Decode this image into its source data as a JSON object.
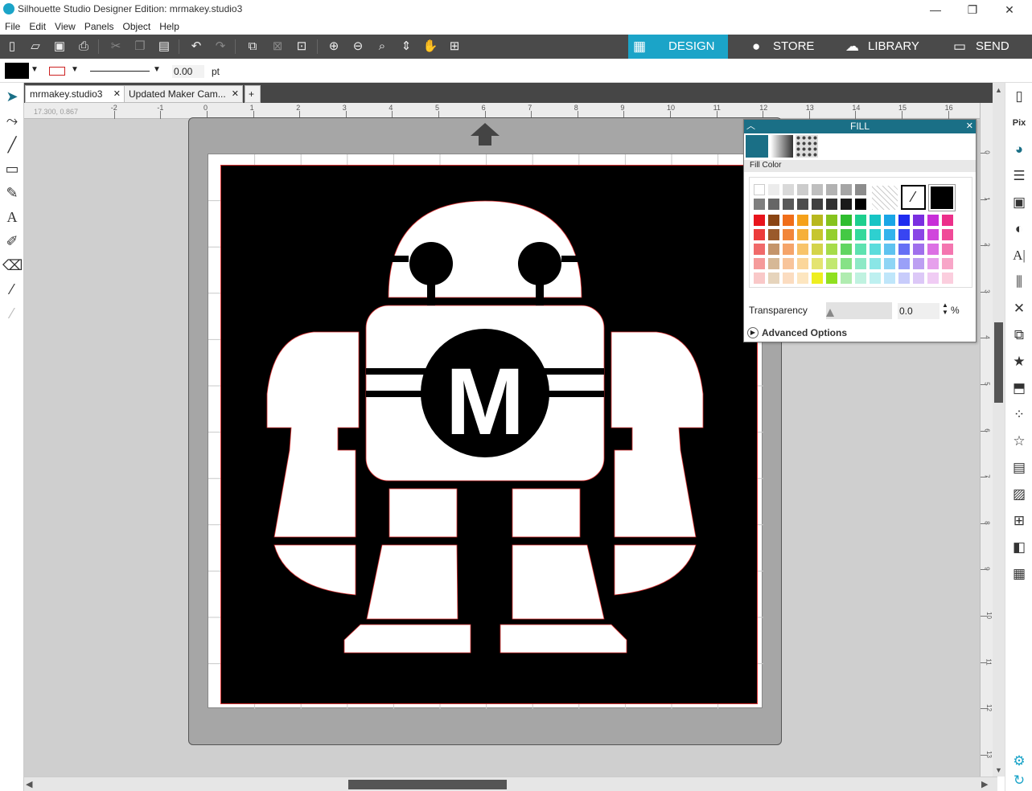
{
  "window": {
    "title": "Silhouette Studio Designer Edition: mrmakey.studio3",
    "minimize": "—",
    "maximize": "❐",
    "close": "✕"
  },
  "menu": [
    "File",
    "Edit",
    "View",
    "Panels",
    "Object",
    "Help"
  ],
  "modes": [
    {
      "label": "DESIGN",
      "icon": "grid-icon",
      "active": true
    },
    {
      "label": "STORE",
      "icon": "silhouette-s-icon",
      "active": false
    },
    {
      "label": "LIBRARY",
      "icon": "cloud-icon",
      "active": false
    },
    {
      "label": "SEND",
      "icon": "cutter-icon",
      "active": false
    }
  ],
  "propbar": {
    "line_width": "0.00",
    "unit": "pt",
    "fill_color": "#000000",
    "line_color": "#cc2222"
  },
  "tabs": [
    {
      "label": "mrmakey.studio3",
      "close": "✕"
    },
    {
      "label": "Updated Maker Cam...",
      "close": "✕"
    },
    {
      "label": "+"
    }
  ],
  "ruler": {
    "coords": "17.300, 0.867",
    "h_ticks": [
      "-2",
      "-1",
      "0",
      "1",
      "2",
      "3",
      "4",
      "5",
      "6",
      "7",
      "8",
      "9",
      "10",
      "11",
      "12",
      "13",
      "14",
      "15",
      "16"
    ],
    "v_ticks": [
      "0",
      "1",
      "2",
      "3",
      "4",
      "5",
      "6",
      "7",
      "8",
      "9",
      "10",
      "11",
      "12",
      "13"
    ]
  },
  "artwork": {
    "monogram": "M",
    "background": "#000000",
    "foreground": "#ffffff",
    "cut_line": "#dd3333"
  },
  "fill_panel": {
    "title": "FILL",
    "section": "Fill Color",
    "transparency_label": "Transparency",
    "transparency_value": "0.0",
    "percent": "%",
    "advanced_label": "Advanced Options",
    "accent": "#1a6f86",
    "selected_color": "#000000",
    "gray_rows": [
      [
        "#ffffff",
        "#ececec",
        "#d9d9d9",
        "#cccccc",
        "#bfbfbf",
        "#b2b2b2",
        "#a5a5a5",
        "#8c8c8c"
      ],
      [
        "#7f7f7f",
        "#666666",
        "#595959",
        "#4d4d4d",
        "#404040",
        "#333333",
        "#1a1a1a",
        "#000000"
      ]
    ],
    "color_rows": [
      [
        "#e8141c",
        "#8b4513",
        "#f06e1a",
        "#f5a11a",
        "#b8b81e",
        "#86c31e",
        "#2fbd2f",
        "#1dcf8e",
        "#17c4c4",
        "#1aa6e6",
        "#1f2cf0",
        "#7a2fe0",
        "#c82fd8",
        "#ec2f8a"
      ],
      [
        "#ec3b3b",
        "#9a5a2b",
        "#f2863a",
        "#f6b03a",
        "#c6c62e",
        "#94cf2e",
        "#44c944",
        "#34d99c",
        "#2ed0d0",
        "#33b3ec",
        "#3845f2",
        "#8a46e6",
        "#d046dc",
        "#f04a98"
      ],
      [
        "#f06a6a",
        "#c4946a",
        "#f5a46a",
        "#f8c46a",
        "#d4d44a",
        "#a6dc4a",
        "#62d562",
        "#5ee2b0",
        "#5cdcdc",
        "#5fc3f0",
        "#6670f5",
        "#a070ec",
        "#dc70e4",
        "#f476b0"
      ],
      [
        "#f59a9a",
        "#d6b896",
        "#f8c49a",
        "#fbd69a",
        "#e4e470",
        "#c2e870",
        "#86e286",
        "#8de9c6",
        "#8ae6e6",
        "#8fd5f5",
        "#9aa0f8",
        "#bd9ff2",
        "#e6a0ec",
        "#f8a6c8"
      ],
      [
        "#f9c8c8",
        "#e6d4bc",
        "#fbdcc0",
        "#fde6c0",
        "#eeee20",
        "#90e020",
        "#b0ecb0",
        "#c0f2e0",
        "#bef0f0",
        "#bfe6fa",
        "#c8ccfb",
        "#dcc8f7",
        "#f0ccf4",
        "#fbcede"
      ]
    ]
  }
}
